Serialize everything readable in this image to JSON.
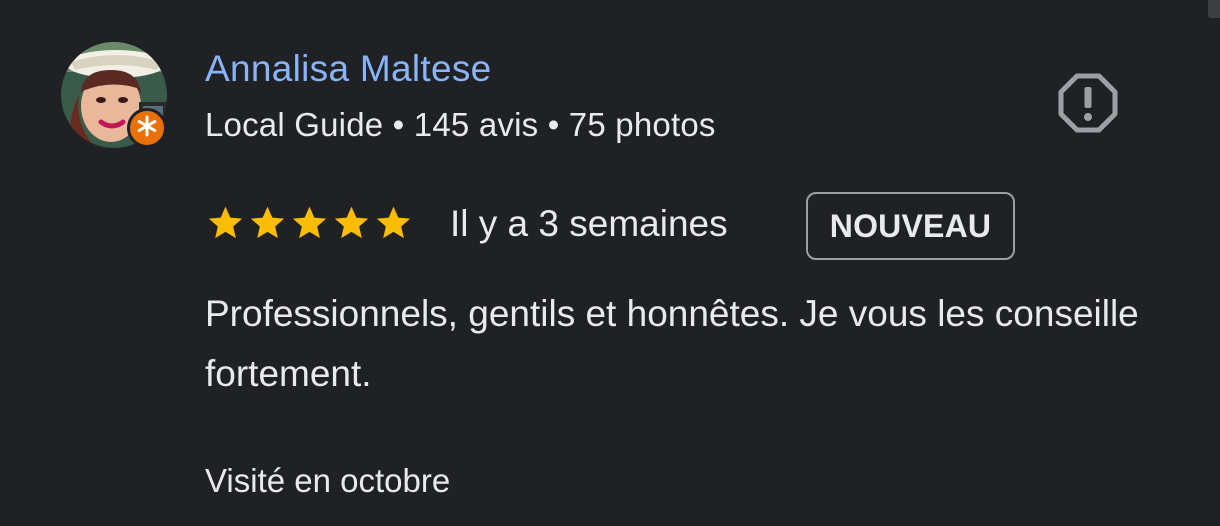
{
  "review": {
    "author_name": "Annalisa Maltese",
    "author_meta": "Local Guide • 145 avis • 75 photos",
    "rating": 5,
    "rating_max": 5,
    "date": "Il y a 3 semaines",
    "new_badge": "NOUVEAU",
    "text": "Professionnels, gentils et honnêtes. Je vous les conseille fortement.",
    "visit": "Visité en octobre"
  },
  "icons": {
    "report": "report-flag-icon",
    "star": "star-icon",
    "guide": "local-guide-star-icon"
  },
  "colors": {
    "background": "#202124",
    "author_link": "#8ab4f8",
    "star": "#fbbc04",
    "guide_badge": "#e8710a",
    "text": "#e8eaed"
  }
}
